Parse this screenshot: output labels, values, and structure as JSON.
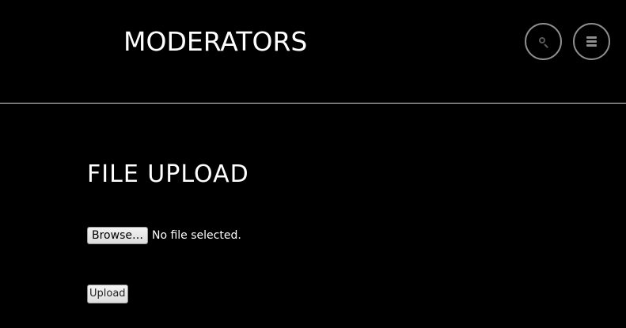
{
  "header": {
    "title": "MODERATORS",
    "search_button_icon": "search-icon",
    "menu_button_icon": "hamburger-menu-icon"
  },
  "main": {
    "heading": "FILE UPLOAD",
    "file_input": {
      "browse_label": "Browse…",
      "status_text": "No file selected."
    },
    "upload_label": "Upload"
  },
  "colors": {
    "background": "#000000",
    "text": "#ffffff",
    "divider": "#d8d8d8",
    "circle_border": "#8e8e8e"
  }
}
